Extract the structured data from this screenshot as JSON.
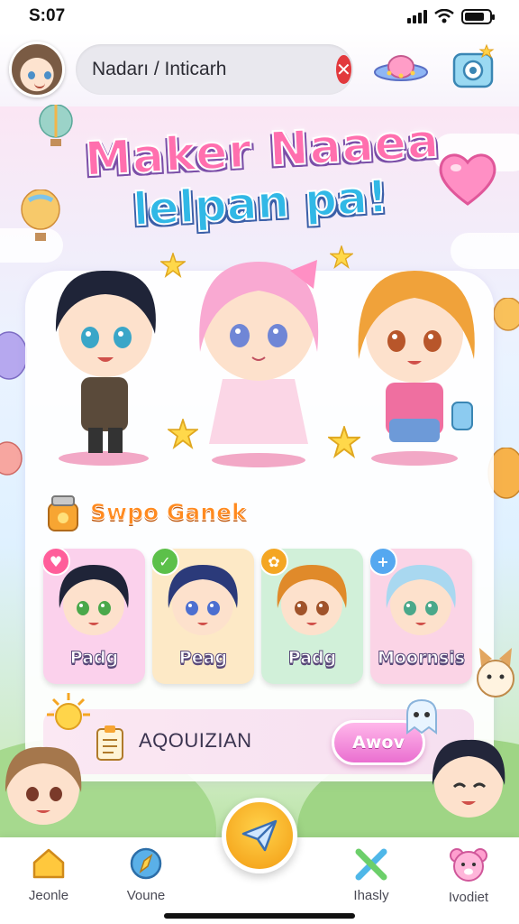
{
  "status_bar": {
    "time": "S:07"
  },
  "header": {
    "search_text": "Nadarı / Inticarh",
    "icons": [
      "avatar",
      "clear-icon",
      "ufo-icon",
      "camera-icon"
    ]
  },
  "hero": {
    "title_line1": "Maker Naaea",
    "title_line2": "lelpan pa!"
  },
  "section": {
    "title": "Swpo Ganek"
  },
  "cards": [
    {
      "label": "Padg",
      "badge": "♥",
      "badge_color": "#ff5e9a",
      "bg": "#fbd1ec"
    },
    {
      "label": "Peag",
      "badge": "✓",
      "badge_color": "#5cc04a",
      "bg": "#fde9c6"
    },
    {
      "label": "Padg",
      "badge": "✿",
      "badge_color": "#f4a623",
      "bg": "#d1f0d9"
    },
    {
      "label": "Moornsis",
      "badge": "+",
      "badge_color": "#55a8f0",
      "bg": "#fbd4e6"
    }
  ],
  "quiz": {
    "label": "AQOUIZIAN",
    "button": "Awov"
  },
  "nav": [
    {
      "label": "Jeonle",
      "icon": "home-icon"
    },
    {
      "label": "Voune",
      "icon": "compass-icon"
    },
    {
      "label": "Ihasly",
      "icon": "tools-icon"
    },
    {
      "label": "Ivodiet",
      "icon": "bear-icon"
    }
  ],
  "colors": {
    "accent": "#ff6fae",
    "fab": "#f7a81b",
    "title2": "#31b8e6",
    "section": "#ff8a1f"
  }
}
